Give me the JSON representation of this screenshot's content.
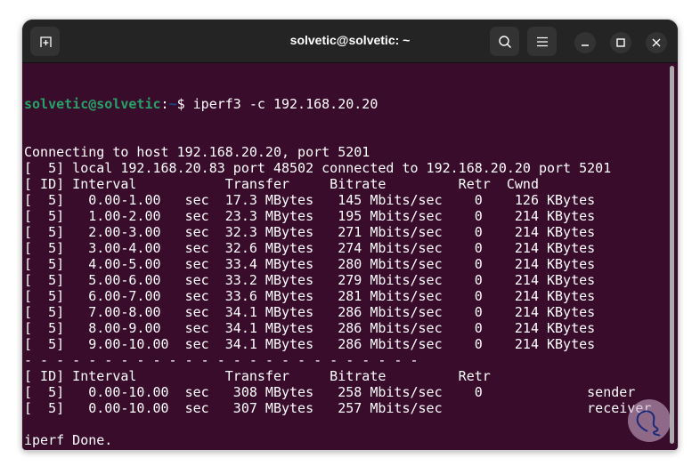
{
  "window": {
    "title": "solvetic@solvetic: ~"
  },
  "prompt": {
    "user": "solvetic@solvetic",
    "colon": ":",
    "path": "~",
    "dollar": "$ "
  },
  "command": "iperf3 -c 192.168.20.20",
  "output": [
    "Connecting to host 192.168.20.20, port 5201",
    "[  5] local 192.168.20.83 port 48502 connected to 192.168.20.20 port 5201",
    "[ ID] Interval           Transfer     Bitrate         Retr  Cwnd",
    "[  5]   0.00-1.00   sec  17.3 MBytes   145 Mbits/sec    0    126 KBytes",
    "[  5]   1.00-2.00   sec  23.3 MBytes   195 Mbits/sec    0    214 KBytes",
    "[  5]   2.00-3.00   sec  32.3 MBytes   271 Mbits/sec    0    214 KBytes",
    "[  5]   3.00-4.00   sec  32.6 MBytes   274 Mbits/sec    0    214 KBytes",
    "[  5]   4.00-5.00   sec  33.4 MBytes   280 Mbits/sec    0    214 KBytes",
    "[  5]   5.00-6.00   sec  33.2 MBytes   279 Mbits/sec    0    214 KBytes",
    "[  5]   6.00-7.00   sec  33.6 MBytes   281 Mbits/sec    0    214 KBytes",
    "[  5]   7.00-8.00   sec  34.1 MBytes   286 Mbits/sec    0    214 KBytes",
    "[  5]   8.00-9.00   sec  34.1 MBytes   286 Mbits/sec    0    214 KBytes",
    "[  5]   9.00-10.00  sec  34.1 MBytes   286 Mbits/sec    0    214 KBytes",
    "- - - - - - - - - - - - - - - - - - - - - - - - -",
    "[ ID] Interval           Transfer     Bitrate         Retr",
    "[  5]   0.00-10.00  sec   308 MBytes   258 Mbits/sec    0             sender",
    "[  5]   0.00-10.00  sec   307 MBytes   257 Mbits/sec                  receiver",
    "",
    "iperf Done."
  ],
  "colors": {
    "terminal_bg": "#380c2a",
    "prompt_user": "#26a269",
    "prompt_path": "#12488b"
  }
}
